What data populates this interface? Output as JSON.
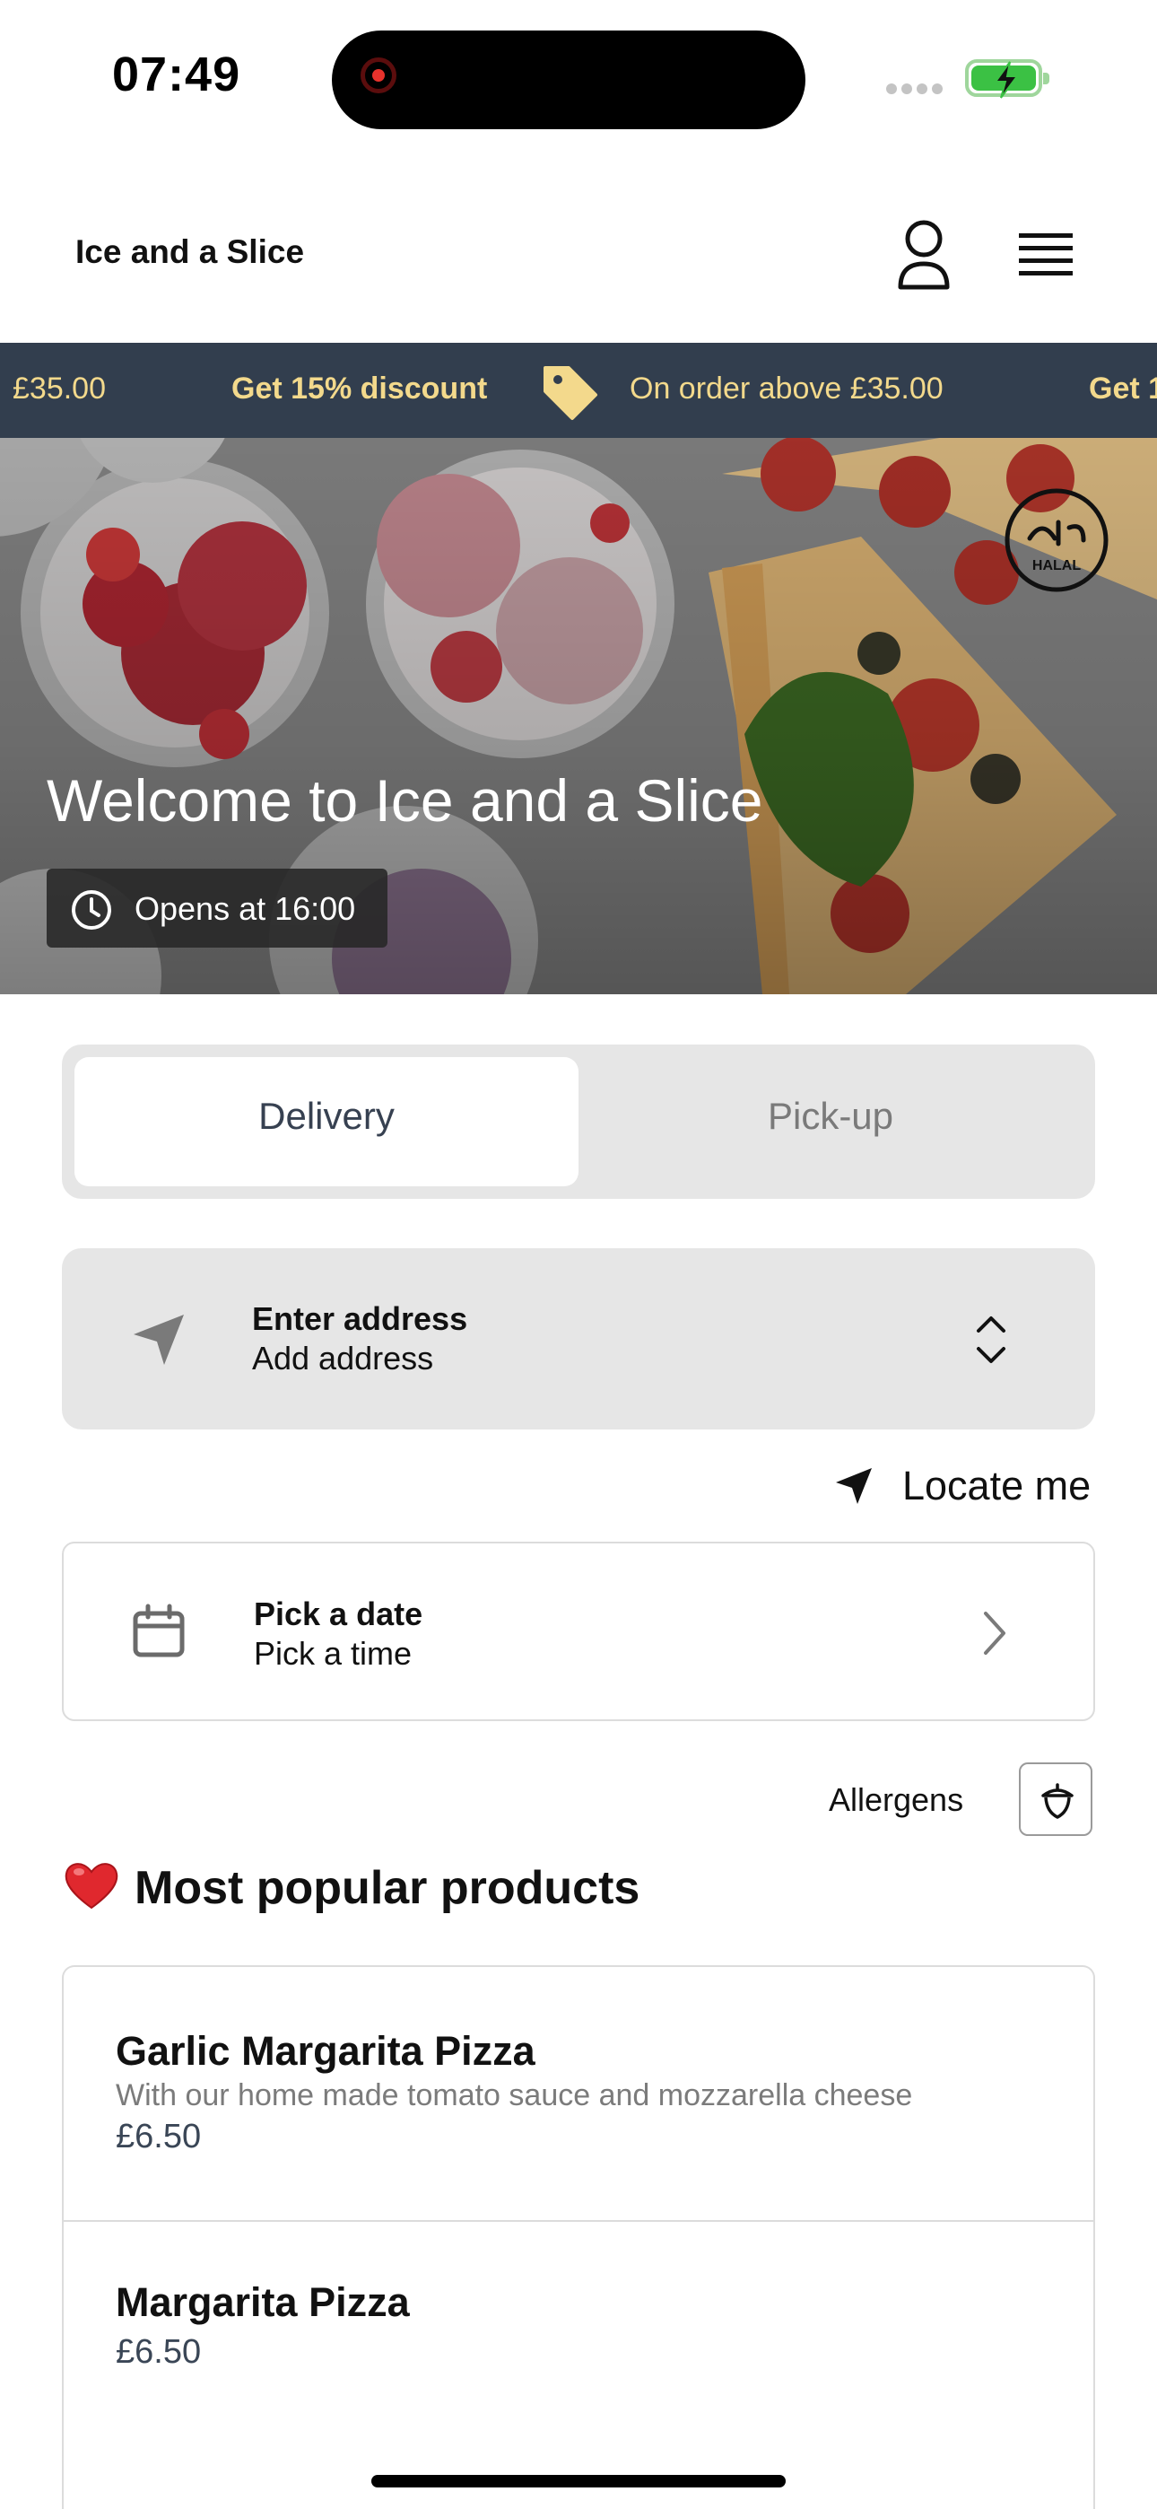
{
  "status_bar": {
    "time": "07:49"
  },
  "header": {
    "brand": "Ice and a Slice"
  },
  "ticker": {
    "items": [
      {
        "text": "£35.00",
        "kind": "condition"
      },
      {
        "text": "Get 15% discount",
        "kind": "promo"
      },
      {
        "text": "On order above £35.00",
        "kind": "condition"
      },
      {
        "text": "Get 1",
        "kind": "promo"
      }
    ]
  },
  "hero": {
    "title": "Welcome to Ice and a Slice",
    "opens": "Opens at 16:00",
    "badge": "HALAL"
  },
  "order_mode": {
    "options": [
      "Delivery",
      "Pick-up"
    ],
    "selected": "Delivery"
  },
  "address": {
    "title": "Enter address",
    "subtitle": "Add address"
  },
  "locate": {
    "label": "Locate me"
  },
  "schedule": {
    "title": "Pick a date",
    "subtitle": "Pick a time"
  },
  "allergens": {
    "label": "Allergens"
  },
  "popular": {
    "title": "Most popular products",
    "products": [
      {
        "name": "Garlic Margarita Pizza",
        "description": "With our home made tomato sauce and mozzarella cheese",
        "price": "£6.50"
      },
      {
        "name": "Margarita Pizza",
        "description": "",
        "price": "£6.50"
      }
    ]
  },
  "colors": {
    "ticker_bg": "#323e4e",
    "ticker_text": "#f3d98c",
    "segment_bg": "#e6e6e6",
    "price_text": "#3a4656"
  }
}
